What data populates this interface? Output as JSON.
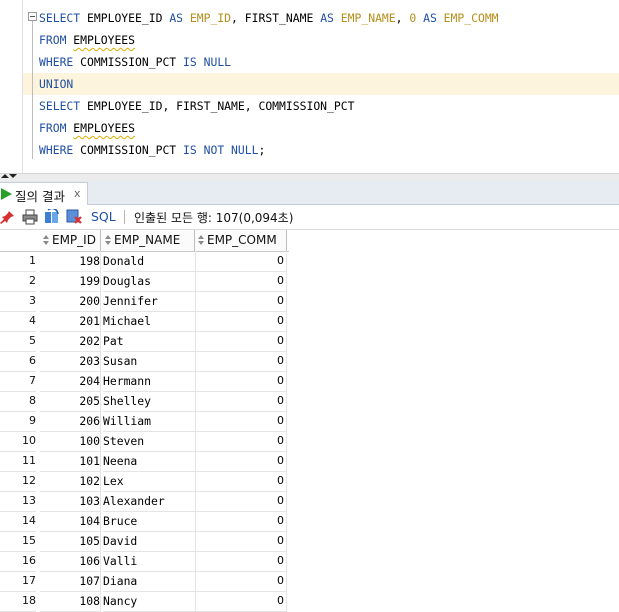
{
  "editor": {
    "lines": [
      [
        [
          "kw",
          "SELECT "
        ],
        [
          "t",
          "EMPLOYEE_ID "
        ],
        [
          "kw",
          "AS "
        ],
        [
          "al",
          "EMP_ID"
        ],
        [
          "t",
          ", FIRST_NAME "
        ],
        [
          "kw",
          "AS "
        ],
        [
          "al",
          "EMP_NAME"
        ],
        [
          "t",
          ", "
        ],
        [
          "num",
          "0 "
        ],
        [
          "kw",
          "AS "
        ],
        [
          "al",
          "EMP_COMM"
        ]
      ],
      [
        [
          "kw",
          "FROM "
        ],
        [
          "sq",
          "EMPLOYEES"
        ]
      ],
      [
        [
          "kw",
          "WHERE "
        ],
        [
          "t",
          "COMMISSION_PCT "
        ],
        [
          "kw",
          "IS NULL"
        ]
      ],
      [
        [
          "kw",
          "UNION"
        ]
      ],
      [
        [
          "kw",
          "SELECT "
        ],
        [
          "t",
          "EMPLOYEE_ID, FIRST_NAME, COMMISSION_PCT"
        ]
      ],
      [
        [
          "kw",
          "FROM "
        ],
        [
          "sq",
          "EMPLOYEES"
        ]
      ],
      [
        [
          "kw",
          "WHERE "
        ],
        [
          "t",
          "COMMISSION_PCT "
        ],
        [
          "kw",
          "IS NOT NULL"
        ],
        [
          "t",
          ";"
        ]
      ]
    ]
  },
  "results_tab": {
    "label": "질의 결과",
    "close": "x"
  },
  "toolbar": {
    "sql_label": "SQL",
    "status": "인출된 모든 행: 107(0,094초)"
  },
  "grid": {
    "columns": [
      "EMP_ID",
      "EMP_NAME",
      "EMP_COMM"
    ],
    "rows": [
      [
        "1",
        "198",
        "Donald",
        "0"
      ],
      [
        "2",
        "199",
        "Douglas",
        "0"
      ],
      [
        "3",
        "200",
        "Jennifer",
        "0"
      ],
      [
        "4",
        "201",
        "Michael",
        "0"
      ],
      [
        "5",
        "202",
        "Pat",
        "0"
      ],
      [
        "6",
        "203",
        "Susan",
        "0"
      ],
      [
        "7",
        "204",
        "Hermann",
        "0"
      ],
      [
        "8",
        "205",
        "Shelley",
        "0"
      ],
      [
        "9",
        "206",
        "William",
        "0"
      ],
      [
        "10",
        "100",
        "Steven",
        "0"
      ],
      [
        "11",
        "101",
        "Neena",
        "0"
      ],
      [
        "12",
        "102",
        "Lex",
        "0"
      ],
      [
        "13",
        "103",
        "Alexander",
        "0"
      ],
      [
        "14",
        "104",
        "Bruce",
        "0"
      ],
      [
        "15",
        "105",
        "David",
        "0"
      ],
      [
        "16",
        "106",
        "Valli",
        "0"
      ],
      [
        "17",
        "107",
        "Diana",
        "0"
      ],
      [
        "18",
        "108",
        "Nancy",
        "0"
      ]
    ]
  },
  "colors": {
    "keyword": "#1f4fa3",
    "alias": "#b58f1a",
    "highlight_row": "#fdf4dd",
    "run_icon": "#29a129"
  },
  "icons": [
    "play-icon",
    "pin-icon",
    "print-icon",
    "refresh-icon",
    "export-icon",
    "sort-icon"
  ]
}
